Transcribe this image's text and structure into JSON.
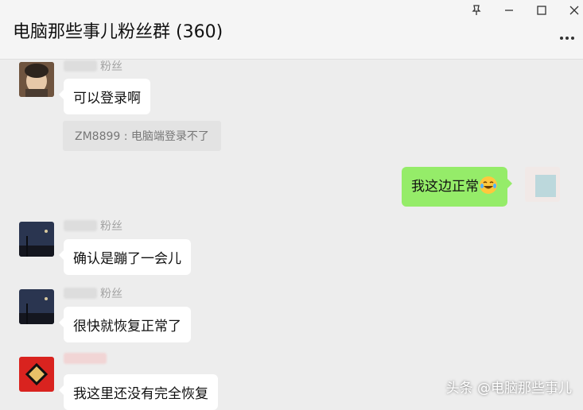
{
  "window": {
    "title": "电脑那些事儿粉丝群 (360)",
    "pin_icon": "pin-icon",
    "minimize_icon": "minimize-icon",
    "maximize_icon": "maximize-icon",
    "close_icon": "close-icon",
    "more_icon": "more-icon"
  },
  "messages": [
    {
      "sender_suffix": "粉丝",
      "text": "可以登录啊"
    },
    {
      "quote": "ZM8899 : 电脑端登录不了"
    },
    {
      "text": "我这边正常"
    },
    {
      "sender_suffix": "粉丝",
      "text": "确认是蹦了一会儿"
    },
    {
      "sender_suffix": "粉丝",
      "text": "很快就恢复正常了"
    },
    {
      "text": "我这里还没有完全恢复"
    }
  ],
  "watermark": "头条 @电脑那些事儿",
  "colors": {
    "self_bubble": "#95ec69",
    "other_bubble": "#ffffff",
    "background": "#ededed"
  }
}
